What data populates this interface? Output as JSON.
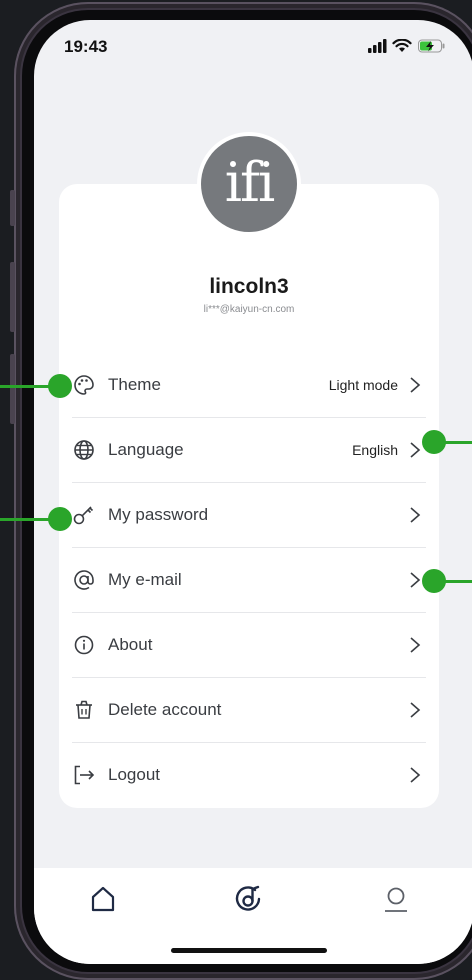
{
  "status_bar": {
    "time": "19:43"
  },
  "profile": {
    "avatar_text": "ifi",
    "username": "lincoln3",
    "email": "li***@kaiyun-cn.com"
  },
  "menu": [
    {
      "label": "Theme",
      "value": "Light mode",
      "icon": "palette-icon"
    },
    {
      "label": "Language",
      "value": "English",
      "icon": "globe-icon"
    },
    {
      "label": "My password",
      "value": "",
      "icon": "key-icon"
    },
    {
      "label": "My e-mail",
      "value": "",
      "icon": "at-sign-icon"
    },
    {
      "label": "About",
      "value": "",
      "icon": "info-icon"
    },
    {
      "label": "Delete account",
      "value": "",
      "icon": "trash-icon"
    },
    {
      "label": "Logout",
      "value": "",
      "icon": "logout-icon"
    }
  ],
  "bottom_nav": [
    "home-icon",
    "music-disc-icon",
    "profile-icon"
  ],
  "colors": {
    "marker": "#2aa52a",
    "screen_bg": "#f0f1f4",
    "card_bg": "#ffffff"
  }
}
